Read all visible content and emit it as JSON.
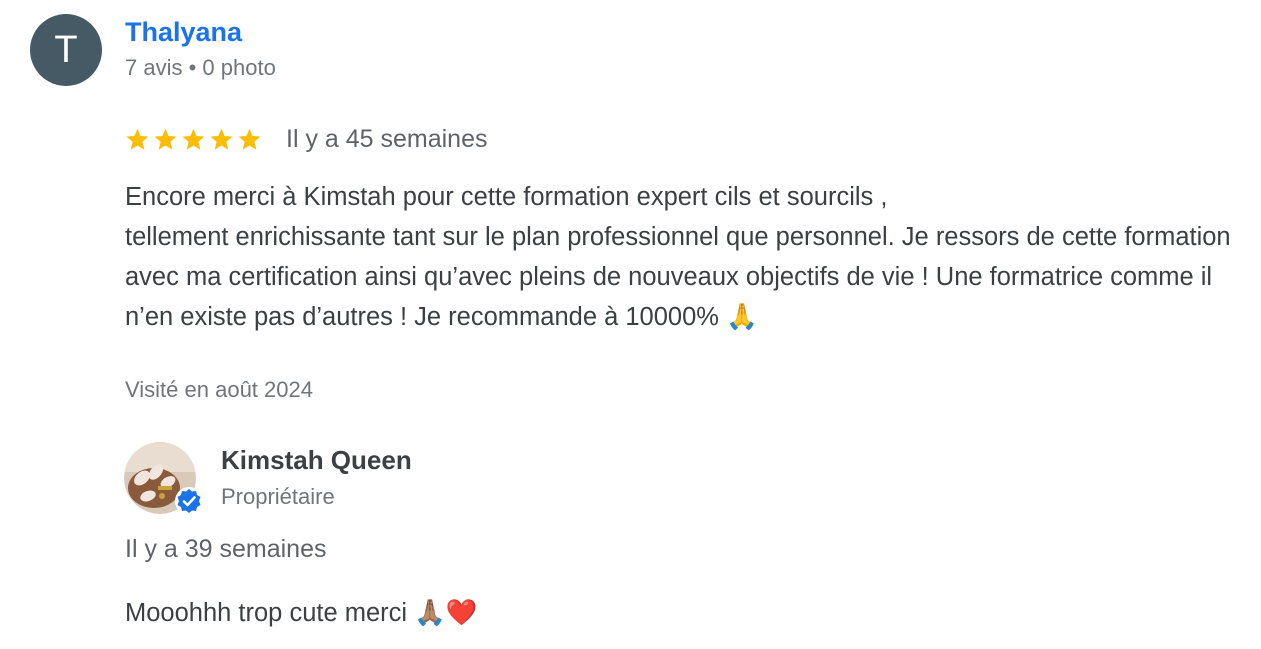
{
  "review": {
    "reviewer": {
      "initial": "T",
      "avatar_color": "#455a64",
      "name": "Thalyana",
      "name_color": "#1a73e8",
      "stats": "7 avis • 0 photo"
    },
    "rating": 5,
    "rating_max": 5,
    "star_color": "#fbbc04",
    "time": "Il y a 45 semaines",
    "text": "Encore merci à Kimstah pour cette formation expert cils et sourcils ,\ntellement enrichissante tant sur le plan professionnel que personnel. Je ressors de cette formation avec ma certification ainsi qu’avec pleins de nouveaux objectifs de vie ! Une formatrice comme il n’en existe pas d’autres ! Je recommande à 10000% 🙏",
    "visited": "Visité en août 2024"
  },
  "owner_reply": {
    "name": "Kimstah Queen",
    "role": "Propriétaire",
    "avatar_icon": "owner-photo",
    "badge_icon": "verified-badge-icon",
    "badge_color": "#1a73e8",
    "time": "Il y a 39 semaines",
    "text": "Mooohhh trop cute merci 🙏🏽❤️"
  }
}
